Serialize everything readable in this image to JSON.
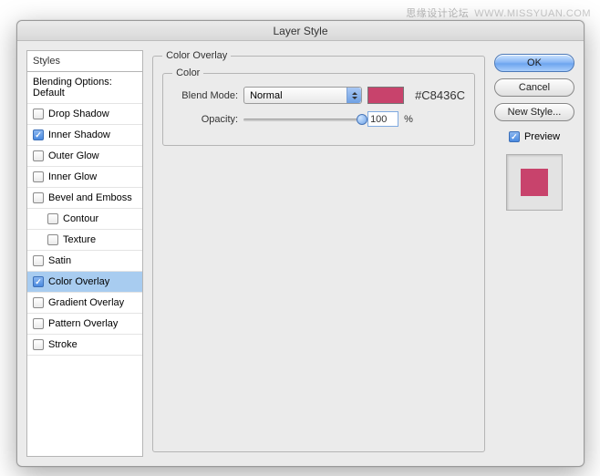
{
  "watermark": {
    "cn": "思缘设计论坛",
    "url": "WWW.MISSYUAN.COM"
  },
  "dialog": {
    "title": "Layer Style"
  },
  "sidebar": {
    "header": "Styles",
    "blending": "Blending Options: Default",
    "items": [
      {
        "label": "Drop Shadow",
        "checked": false
      },
      {
        "label": "Inner Shadow",
        "checked": true
      },
      {
        "label": "Outer Glow",
        "checked": false
      },
      {
        "label": "Inner Glow",
        "checked": false
      },
      {
        "label": "Bevel and Emboss",
        "checked": false
      },
      {
        "label": "Contour",
        "checked": false,
        "indent": true
      },
      {
        "label": "Texture",
        "checked": false,
        "indent": true
      },
      {
        "label": "Satin",
        "checked": false
      },
      {
        "label": "Color Overlay",
        "checked": true,
        "selected": true
      },
      {
        "label": "Gradient Overlay",
        "checked": false
      },
      {
        "label": "Pattern Overlay",
        "checked": false
      },
      {
        "label": "Stroke",
        "checked": false
      }
    ]
  },
  "panel": {
    "title": "Color Overlay",
    "group": "Color",
    "blendModeLabel": "Blend Mode:",
    "blendModeValue": "Normal",
    "hex": "#C8436C",
    "opacityLabel": "Opacity:",
    "opacityValue": "100",
    "pct": "%"
  },
  "buttons": {
    "ok": "OK",
    "cancel": "Cancel",
    "newStyle": "New Style...",
    "preview": "Preview"
  },
  "colors": {
    "overlay": "#C8436C"
  }
}
